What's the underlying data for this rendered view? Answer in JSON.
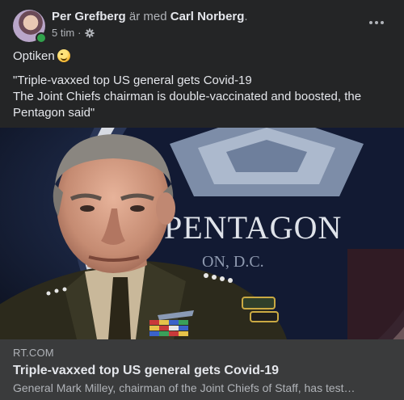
{
  "post": {
    "author": "Per Grefberg",
    "with_text": "är med",
    "tagged": "Carl Norberg",
    "name_end": ".",
    "time": "5 tim",
    "separator": "·",
    "privacy_icon": "gear-icon",
    "more_icon": "more-options-icon",
    "text_line1": "Optiken",
    "emoji": "winking-face-emoji",
    "quote_line1": "\"Triple-vaxxed top US general gets Covid-19",
    "quote_line2": "The Joint Chiefs chairman is double-vaccinated and boosted, the Pentagon said\""
  },
  "image": {
    "sign_text": "PENTAGON",
    "sign_subtext": "ON, D.C."
  },
  "link": {
    "domain": "RT.COM",
    "title": "Triple-vaxxed top US general gets Covid-19",
    "description": "General Mark Milley, chairman of the Joint Chiefs of Staff, has test…"
  },
  "colors": {
    "background": "#242526",
    "link_background": "#3a3b3c",
    "primary_text": "#e4e6eb",
    "secondary_text": "#b0b3b8",
    "online": "#31a24c"
  }
}
